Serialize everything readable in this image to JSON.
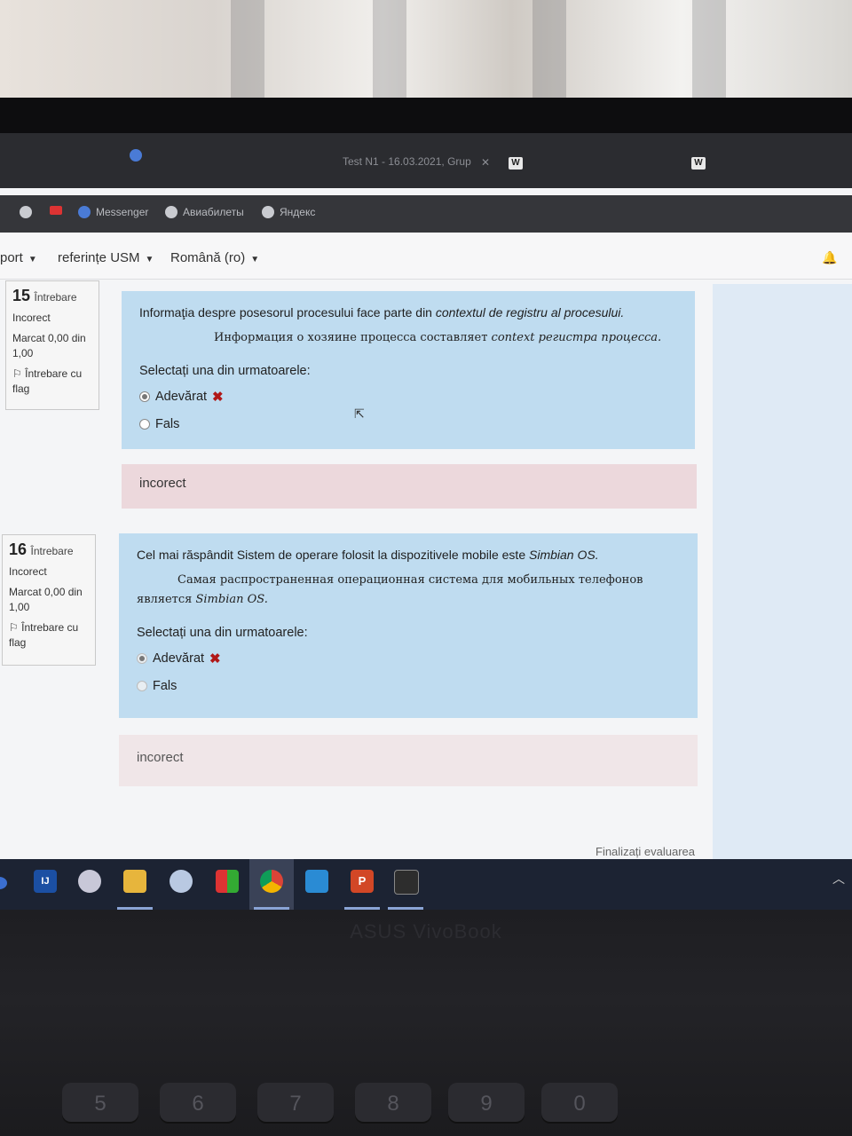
{
  "browser": {
    "active_tab_title": "Test N1 - 16.03.2021, Grup",
    "bookmarks": [
      "Messenger",
      "Авиабилеты",
      "Яндекс"
    ]
  },
  "navbar": {
    "items": [
      "port",
      "referințe USM",
      "Română (ro)"
    ]
  },
  "questions": [
    {
      "number": "15",
      "word": "Întrebare",
      "status": "Incorect",
      "mark": "Marcat 0,00 din 1,00",
      "flag": "Întrebare cu flag",
      "text_plain": "Informaţia despre posesorul procesului face parte din ",
      "text_italic": "contextul de registru al procesului.",
      "text_ru_plain": "Информация  о хозяине процесса составляет  ",
      "text_ru_italic": "context  регистра  процесса.",
      "prompt": "Selectați una din urmatoarele:",
      "options": [
        "Adevărat",
        "Fals"
      ],
      "feedback": "incorect"
    },
    {
      "number": "16",
      "word": "Întrebare",
      "status": "Incorect",
      "mark": "Marcat 0,00 din 1,00",
      "flag": "Întrebare cu flag",
      "text_plain": "Cel mai răspândit Sistem de operare folosit la dispozitivele mobile este ",
      "text_italic": "Simbian OS.",
      "text_ru_plain": "Самая распространенная операционная система для мобильных телефонов является ",
      "text_ru_italic": "Simbian OS.",
      "prompt": "Selectați una din urmatoarele:",
      "options": [
        "Adevărat",
        "Fals"
      ],
      "feedback": "incorect"
    }
  ],
  "finish_link": "Finalizați evaluarea",
  "laptop": {
    "brand": "ASUS VivoBook",
    "keys": [
      "5",
      "6",
      "7",
      "8",
      "9",
      "0"
    ]
  }
}
